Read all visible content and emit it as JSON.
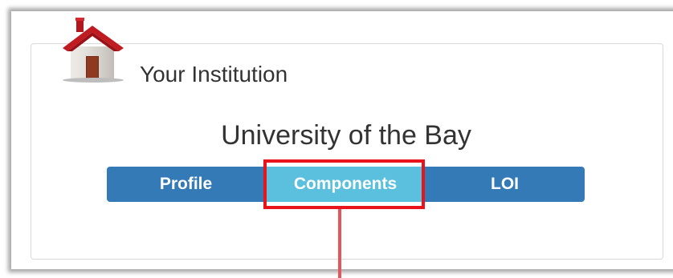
{
  "institution": {
    "heading": "Your Institution",
    "name": "University of the Bay",
    "icon": "house-icon"
  },
  "nav_buttons": [
    {
      "label": "Profile",
      "active": false
    },
    {
      "label": "Components",
      "active": true
    },
    {
      "label": "LOI",
      "active": false
    }
  ],
  "annotation": {
    "highlight_color": "#e8131b",
    "highlighted_item": "Components"
  },
  "colors": {
    "primary": "#337ab7",
    "active": "#5bc0de",
    "text": "#333333"
  }
}
